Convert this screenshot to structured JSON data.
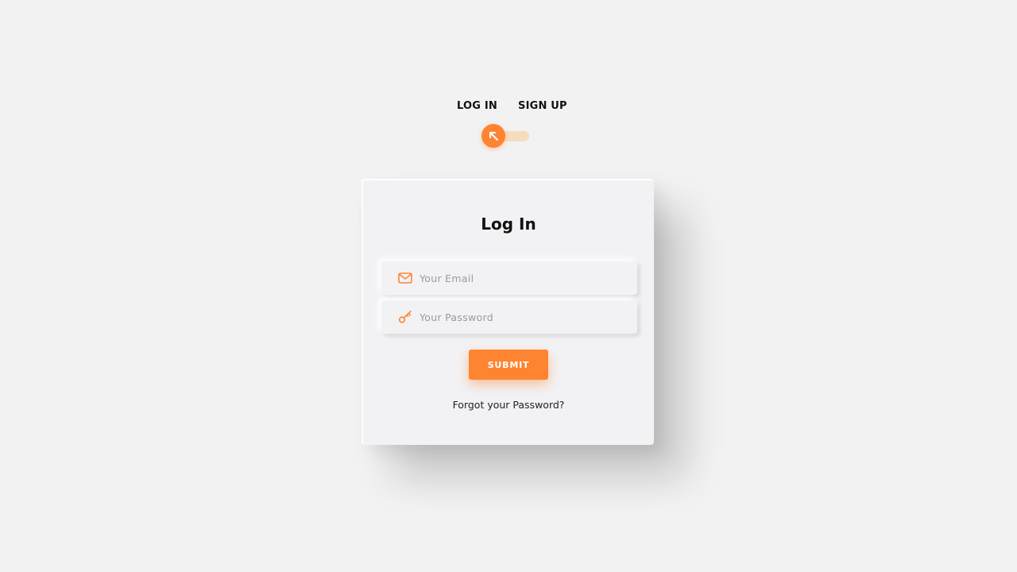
{
  "mode_toggle": {
    "login_label": "LOG IN",
    "signup_label": "SIGN UP",
    "icon": "arrow-up-left-icon",
    "state": "log-in"
  },
  "card": {
    "title": "Log In",
    "email": {
      "icon": "mail-icon",
      "placeholder": "Your Email",
      "value": ""
    },
    "password": {
      "icon": "key-icon",
      "placeholder": "Your Password",
      "value": ""
    },
    "submit_label": "SUBMIT",
    "forgot_label": "Forgot your Password?"
  },
  "colors": {
    "accent": "#ff8431",
    "toggle_track": "#f6dcbf",
    "background": "#f2f2f2",
    "card": "#f2f2f4"
  }
}
